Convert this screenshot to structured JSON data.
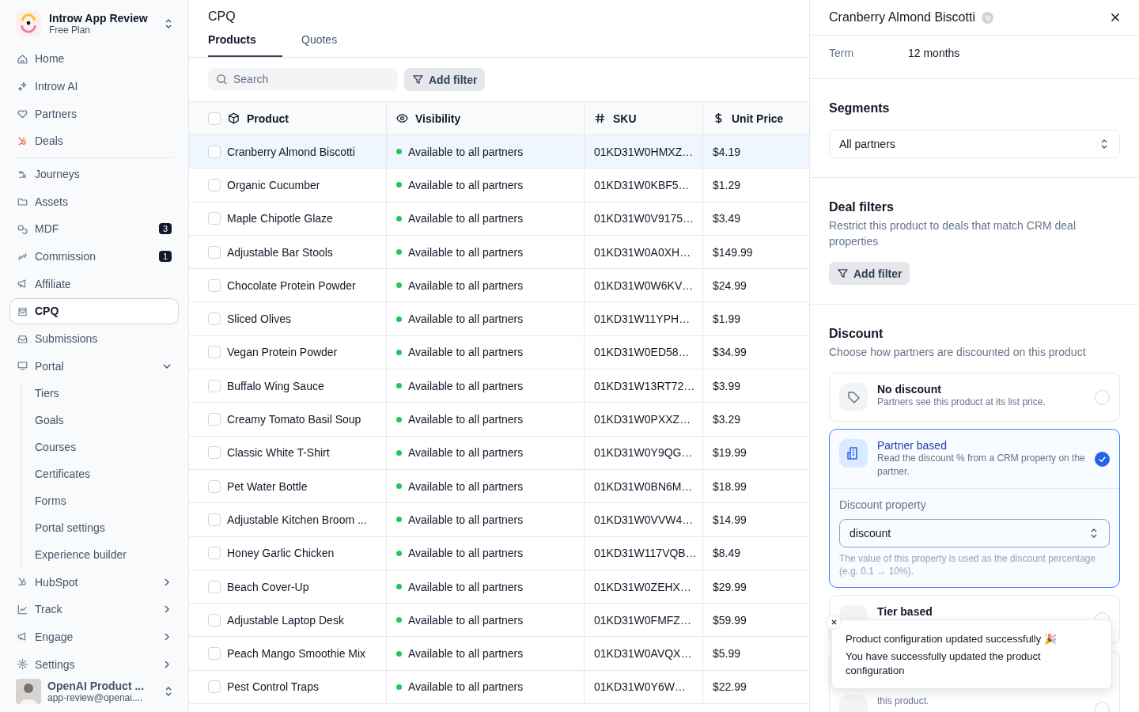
{
  "sidebar": {
    "workspace": {
      "name": "Introw App Review",
      "plan": "Free Plan"
    },
    "groups": [
      {
        "items": [
          {
            "label": "Home",
            "selected": false
          },
          {
            "label": "Introw AI",
            "selected": false
          },
          {
            "label": "Partners",
            "selected": false
          },
          {
            "label": "Deals",
            "selected": false
          }
        ]
      },
      {
        "items": [
          {
            "label": "Journeys",
            "selected": false
          },
          {
            "label": "Assets",
            "selected": false
          },
          {
            "label": "MDF",
            "selected": false,
            "badge": "3"
          },
          {
            "label": "Commission",
            "selected": false,
            "badge": "1"
          },
          {
            "label": "Affiliate",
            "selected": false
          },
          {
            "label": "CPQ",
            "selected": true
          },
          {
            "label": "Submissions",
            "selected": false
          },
          {
            "label": "Portal",
            "selected": false,
            "expanded": true,
            "children": [
              {
                "label": "Tiers",
                "selected": false
              },
              {
                "label": "Goals",
                "selected": false
              },
              {
                "label": "Courses",
                "selected": false
              },
              {
                "label": "Certificates",
                "selected": false
              },
              {
                "label": "Forms",
                "selected": false
              },
              {
                "label": "Portal settings",
                "selected": false
              },
              {
                "label": "Experience builder",
                "selected": false
              }
            ]
          },
          {
            "label": "HubSpot",
            "selected": false,
            "expanded": false
          },
          {
            "label": "Track",
            "selected": false,
            "expanded": false
          },
          {
            "label": "Engage",
            "selected": false,
            "expanded": false
          },
          {
            "label": "Settings",
            "selected": false,
            "expanded": false
          }
        ]
      }
    ],
    "user": {
      "name": "OpenAI Product ...",
      "email": "app-review@openai...."
    }
  },
  "page": {
    "title": "CPQ",
    "tabs": [
      {
        "label": "Products",
        "selected": true
      },
      {
        "label": "Quotes",
        "selected": false
      }
    ],
    "search": {
      "placeholder": "Search"
    },
    "filter_button": "Add filter"
  },
  "table": {
    "columns": [
      "Product",
      "Visibility",
      "SKU",
      "Unit Price"
    ],
    "header_checked": false,
    "rows": [
      {
        "product": "Cranberry Almond Biscotti",
        "visibility": "Available to all partners",
        "sku": "01KD31W0HMXZ…",
        "price": "$4.19",
        "selected": true,
        "checked": false
      },
      {
        "product": "Organic Cucumber",
        "visibility": "Available to all partners",
        "sku": "01KD31W0KBF5…",
        "price": "$1.29",
        "selected": false,
        "checked": false
      },
      {
        "product": "Maple Chipotle Glaze",
        "visibility": "Available to all partners",
        "sku": "01KD31W0V9175…",
        "price": "$3.49",
        "selected": false,
        "checked": false
      },
      {
        "product": "Adjustable Bar Stools",
        "visibility": "Available to all partners",
        "sku": "01KD31W0A0XH…",
        "price": "$149.99",
        "selected": false,
        "checked": false
      },
      {
        "product": "Chocolate Protein Powder",
        "visibility": "Available to all partners",
        "sku": "01KD31W0W6KV…",
        "price": "$24.99",
        "selected": false,
        "checked": false
      },
      {
        "product": "Sliced Olives",
        "visibility": "Available to all partners",
        "sku": "01KD31W11YPH…",
        "price": "$1.99",
        "selected": false,
        "checked": false
      },
      {
        "product": "Vegan Protein Powder",
        "visibility": "Available to all partners",
        "sku": "01KD31W0ED58…",
        "price": "$34.99",
        "selected": false,
        "checked": false
      },
      {
        "product": "Buffalo Wing Sauce",
        "visibility": "Available to all partners",
        "sku": "01KD31W13RT72…",
        "price": "$3.99",
        "selected": false,
        "checked": false
      },
      {
        "product": "Creamy Tomato Basil Soup",
        "visibility": "Available to all partners",
        "sku": "01KD31W0PXXZ…",
        "price": "$3.29",
        "selected": false,
        "checked": false
      },
      {
        "product": "Classic White T-Shirt",
        "visibility": "Available to all partners",
        "sku": "01KD31W0Y9QG…",
        "price": "$19.99",
        "selected": false,
        "checked": false
      },
      {
        "product": "Pet Water Bottle",
        "visibility": "Available to all partners",
        "sku": "01KD31W0BN6M…",
        "price": "$18.99",
        "selected": false,
        "checked": false
      },
      {
        "product": "Adjustable Kitchen Broom ...",
        "visibility": "Available to all partners",
        "sku": "01KD31W0VVW4…",
        "price": "$14.99",
        "selected": false,
        "checked": false
      },
      {
        "product": "Honey Garlic Chicken",
        "visibility": "Available to all partners",
        "sku": "01KD31W117VQB…",
        "price": "$8.49",
        "selected": false,
        "checked": false
      },
      {
        "product": "Beach Cover-Up",
        "visibility": "Available to all partners",
        "sku": "01KD31W0ZEHX…",
        "price": "$29.99",
        "selected": false,
        "checked": false
      },
      {
        "product": "Adjustable Laptop Desk",
        "visibility": "Available to all partners",
        "sku": "01KD31W0FMFZ…",
        "price": "$59.99",
        "selected": false,
        "checked": false
      },
      {
        "product": "Peach Mango Smoothie Mix",
        "visibility": "Available to all partners",
        "sku": "01KD31W0AVQX…",
        "price": "$5.99",
        "selected": false,
        "checked": false
      },
      {
        "product": "Pest Control Traps",
        "visibility": "Available to all partners",
        "sku": "01KD31W0Y6W…",
        "price": "$22.99",
        "selected": false,
        "checked": false
      }
    ]
  },
  "panel": {
    "title": "Cranberry Almond Biscotti",
    "term": {
      "label": "Term",
      "value": "12 months"
    },
    "segments": {
      "title": "Segments",
      "value": "All partners"
    },
    "deal_filters": {
      "title": "Deal filters",
      "description": "Restrict this product to deals that match CRM deal properties",
      "button": "Add filter"
    },
    "discount": {
      "title": "Discount",
      "description": "Choose how partners are discounted on this product",
      "options": [
        {
          "title": "No discount",
          "description": "Partners see this product at its list price.",
          "selected": false
        },
        {
          "title": "Partner based",
          "description": "Read the discount % from a CRM property on the partner.",
          "selected": true,
          "property_label": "Discount property",
          "property_value": "discount",
          "property_hint": "The value of this property is used as the discount percentage (e.g. 0.1 → 10%)."
        },
        {
          "title": "Tier based",
          "selected": false
        },
        {
          "description": "this product.",
          "selected": false
        }
      ]
    }
  },
  "toast": {
    "title": "Product configuration updated successfully 🎉",
    "message": "You have successfully updated the product configuration"
  }
}
